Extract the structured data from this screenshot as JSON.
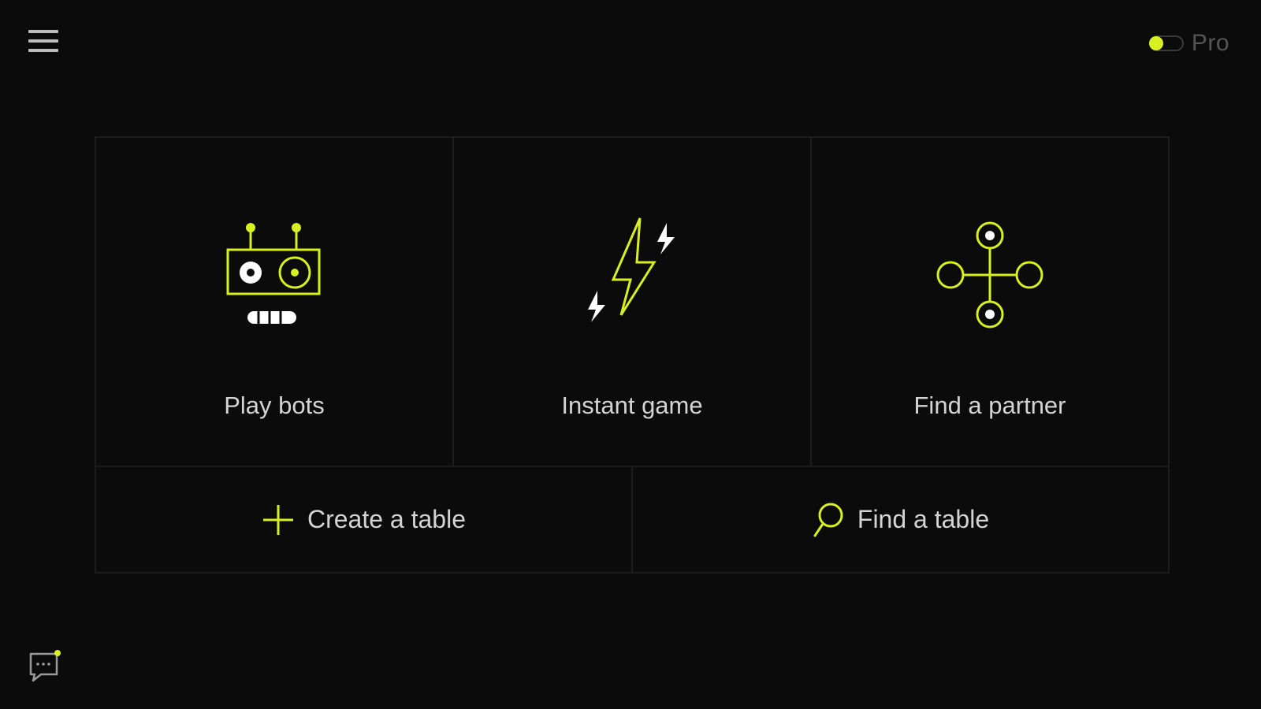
{
  "header": {
    "menu_icon": "hamburger-menu-icon",
    "pro_toggle": {
      "label": "Pro",
      "enabled": false
    }
  },
  "tiles": [
    {
      "label": "Play bots",
      "icon": "robot-icon"
    },
    {
      "label": "Instant game",
      "icon": "lightning-icon"
    },
    {
      "label": "Find a partner",
      "icon": "partner-cross-icon"
    }
  ],
  "actions": [
    {
      "label": "Create a table",
      "icon": "plus-icon"
    },
    {
      "label": "Find a table",
      "icon": "search-icon"
    }
  ],
  "footer": {
    "chat_icon": "chat-bubble-icon",
    "has_unread": true
  },
  "colors": {
    "accent": "#d8f020",
    "background": "#0b0b0c",
    "divider": "#1c1c1e",
    "text": "#d4d4d4",
    "muted": "#555555"
  }
}
